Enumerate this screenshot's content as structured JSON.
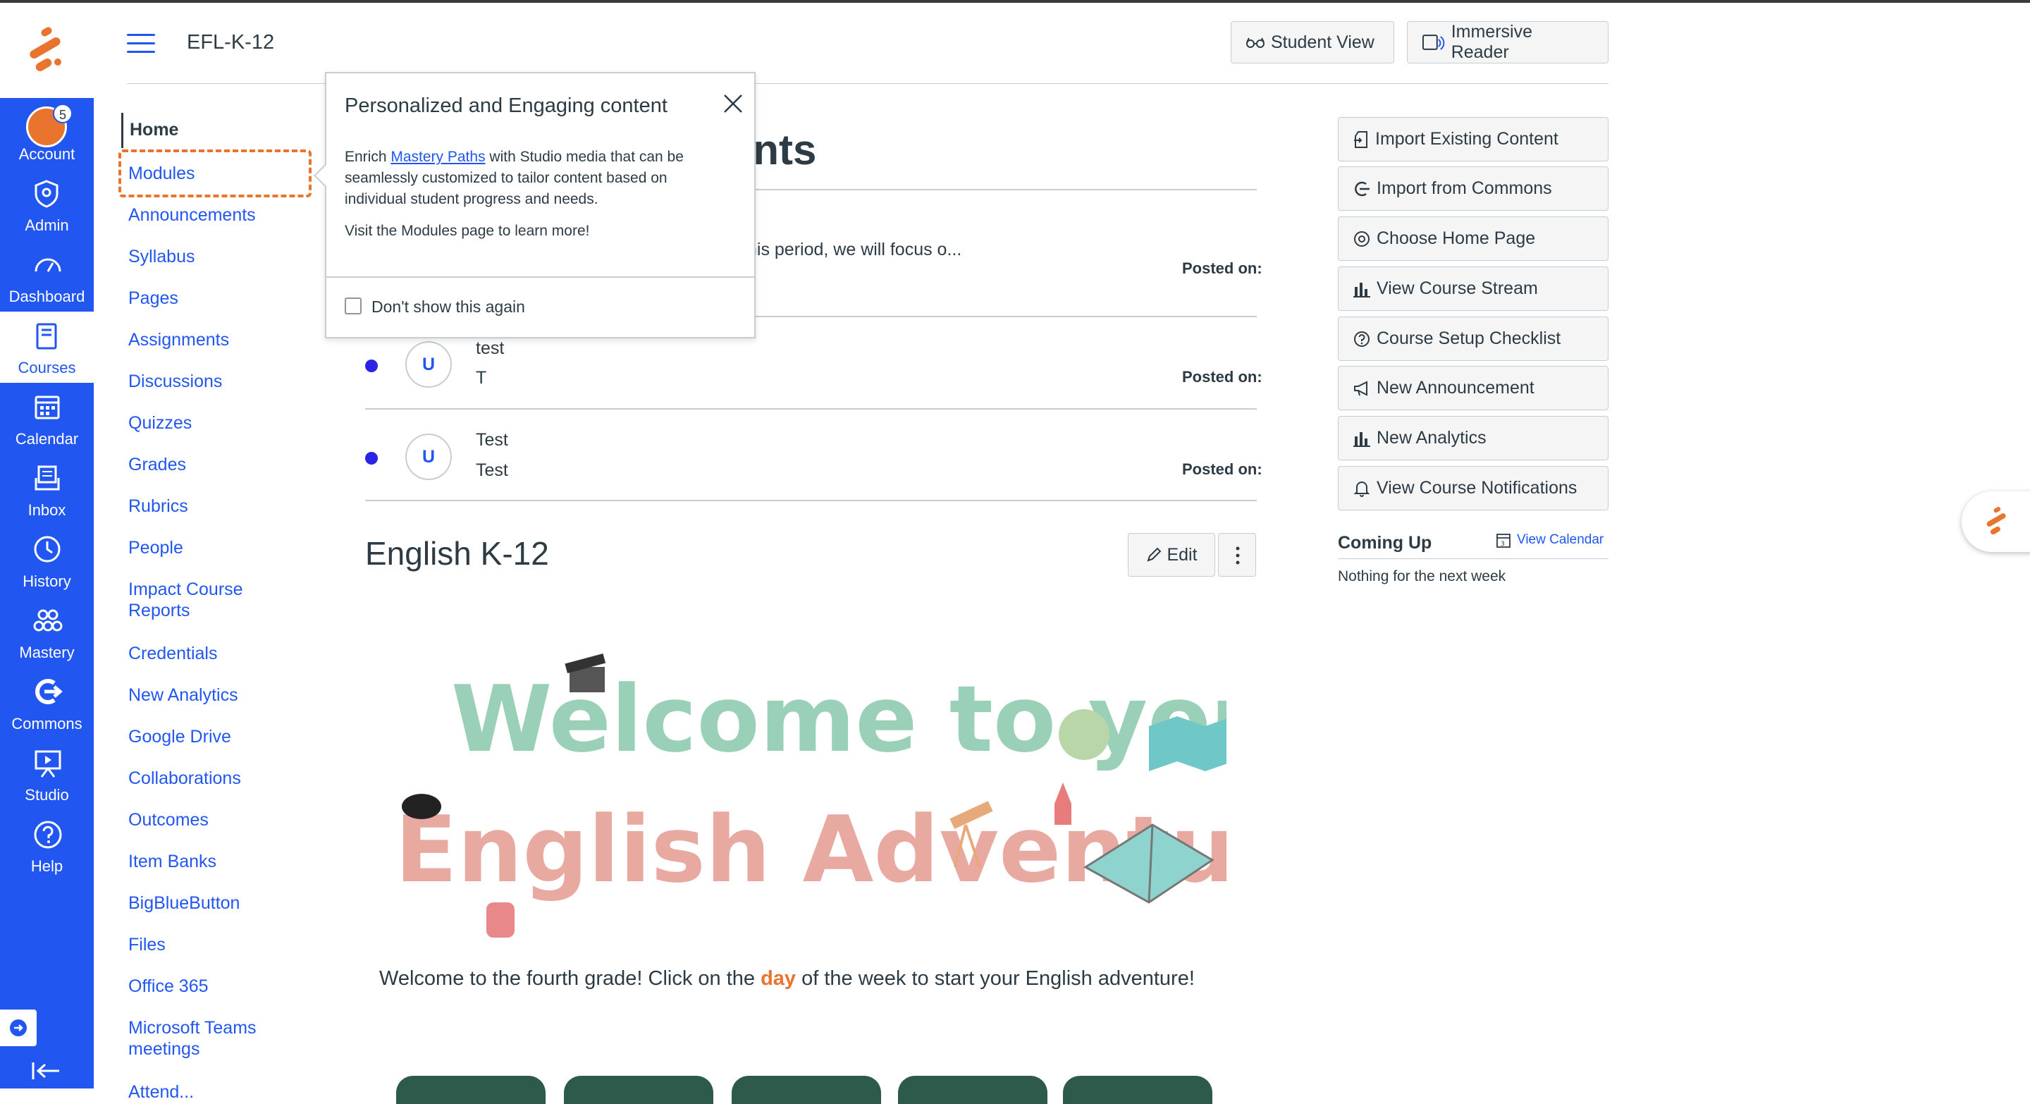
{
  "colors": {
    "nav_bg": "#2256f1",
    "accent": "#e8742e",
    "link": "#2256f1",
    "unread_dot": "#2b24e6"
  },
  "global_nav": {
    "badge_count": "5",
    "items": [
      {
        "label": "Account",
        "icon": "avatar"
      },
      {
        "label": "Admin",
        "icon": "shield-icon"
      },
      {
        "label": "Dashboard",
        "icon": "dashboard-icon"
      },
      {
        "label": "Courses",
        "icon": "book-icon"
      },
      {
        "label": "Calendar",
        "icon": "calendar-icon"
      },
      {
        "label": "Inbox",
        "icon": "inbox-icon"
      },
      {
        "label": "History",
        "icon": "clock-icon"
      },
      {
        "label": "Mastery",
        "icon": "mastery-icon"
      },
      {
        "label": "Commons",
        "icon": "commons-icon"
      },
      {
        "label": "Studio",
        "icon": "studio-icon"
      },
      {
        "label": "Help",
        "icon": "help-icon"
      }
    ]
  },
  "header": {
    "course_title": "EFL-K-12",
    "student_view": "Student View",
    "immersive_reader": "Immersive Reader"
  },
  "course_nav": {
    "home": "Home",
    "items": [
      "Modules",
      "Announcements",
      "Syllabus",
      "Pages",
      "Assignments",
      "Discussions",
      "Quizzes",
      "Grades",
      "Rubrics",
      "People",
      "Impact Course Reports",
      "Credentials",
      "New Analytics",
      "Google Drive",
      "Collaborations",
      "Outcomes",
      "Item Banks",
      "BigBlueButton",
      "Files",
      "Office 365",
      "Microsoft Teams meetings",
      "Attend..."
    ]
  },
  "popover": {
    "title": "Personalized and Engaging content",
    "body_pre": "Enrich ",
    "body_link": "Mastery Paths",
    "body_post": " with Studio media that can be seamlessly customized to tailor content based on individual student progress and needs.",
    "visit": "Visit the Modules page to learn more!",
    "checkbox_label": "Don't show this again"
  },
  "announcements": {
    "heading_partial": "ents",
    "first_truncated": "his period, we will focus o...",
    "posted_label": "Posted on:",
    "items": [
      {
        "avatar": "U",
        "title": "test",
        "message": "T"
      },
      {
        "avatar": "U",
        "title": "Test",
        "message": "Test"
      }
    ]
  },
  "page": {
    "title": "English K-12",
    "edit": "Edit",
    "banner_line1": "Welcome to your",
    "banner_line2": "English Adventure!",
    "welcome_pre": "Welcome to the fourth grade! Click on the ",
    "welcome_hl": "day",
    "welcome_post": " of the week to start your English adventure!"
  },
  "sidebar": {
    "buttons": [
      "Import Existing Content",
      "Import from Commons",
      "Choose Home Page",
      "View Course Stream",
      "Course Setup Checklist",
      "New Announcement",
      "New Analytics",
      "View Course Notifications"
    ],
    "coming_up": "Coming Up",
    "view_calendar": "View Calendar",
    "nothing": "Nothing for the next week"
  }
}
